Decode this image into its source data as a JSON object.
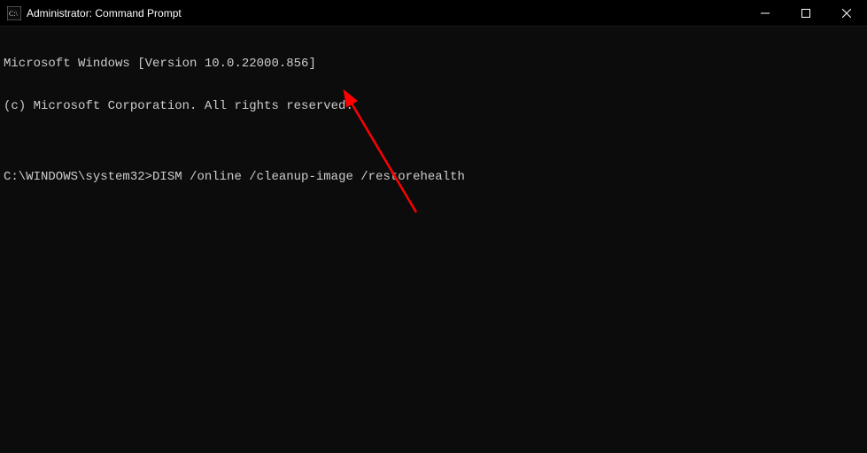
{
  "titlebar": {
    "title": "Administrator: Command Prompt"
  },
  "terminal": {
    "line1": "Microsoft Windows [Version 10.0.22000.856]",
    "line2": "(c) Microsoft Corporation. All rights reserved.",
    "blank": "",
    "prompt": "C:\\WINDOWS\\system32>",
    "command": "DISM /online /cleanup-image /restorehealth"
  },
  "annotation": {
    "arrow_color": "#ff0000"
  }
}
